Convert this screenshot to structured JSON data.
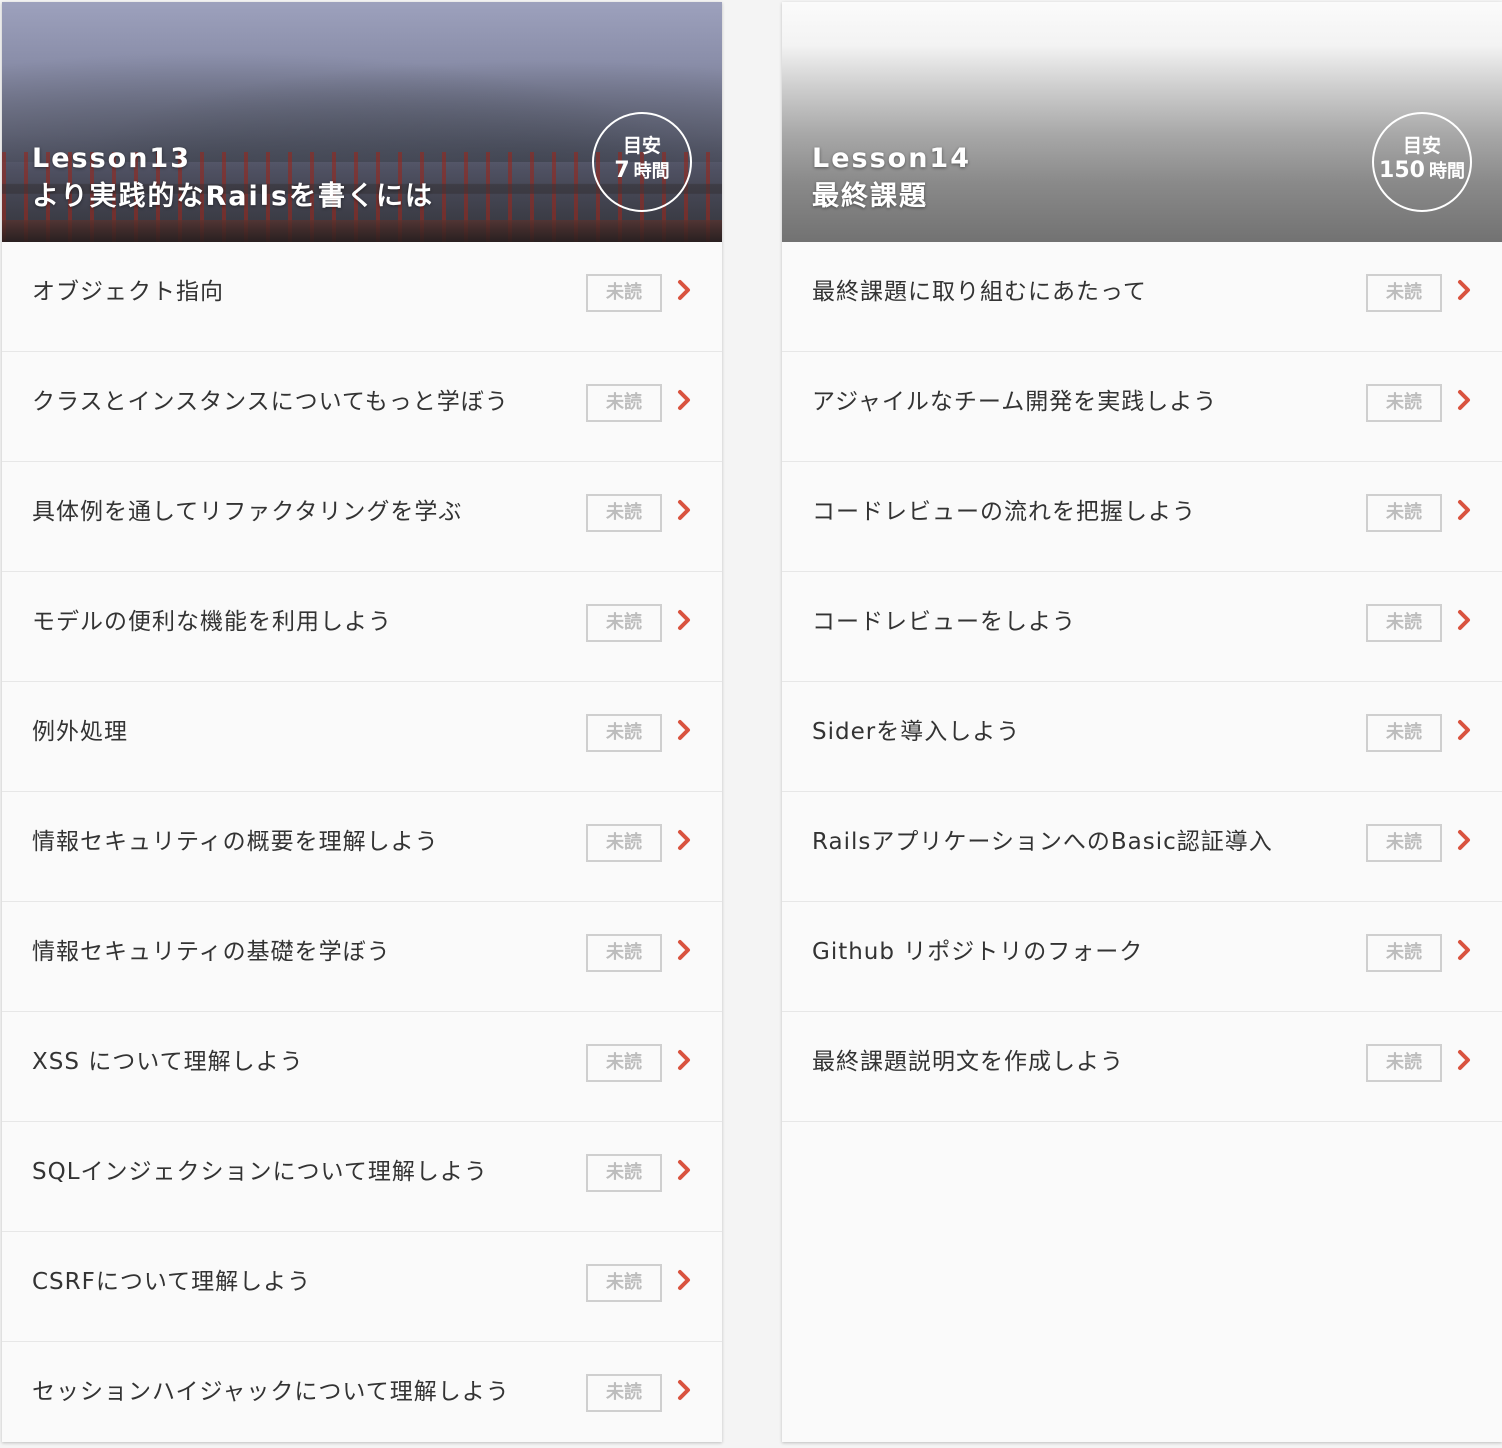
{
  "lessons": [
    {
      "lesson_no": "Lesson13",
      "lesson_name": "より実践的なRailsを書くには",
      "estimate_label": "目安",
      "estimate_value": "7",
      "estimate_unit": "時間",
      "items": [
        {
          "title": "オブジェクト指向",
          "status": "未読"
        },
        {
          "title": "クラスとインスタンスについてもっと学ぼう",
          "status": "未読"
        },
        {
          "title": "具体例を通してリファクタリングを学ぶ",
          "status": "未読"
        },
        {
          "title": "モデルの便利な機能を利用しよう",
          "status": "未読"
        },
        {
          "title": "例外処理",
          "status": "未読"
        },
        {
          "title": "情報セキュリティの概要を理解しよう",
          "status": "未読"
        },
        {
          "title": "情報セキュリティの基礎を学ぼう",
          "status": "未読"
        },
        {
          "title": "XSS について理解しよう",
          "status": "未読"
        },
        {
          "title": "SQLインジェクションについて理解しよう",
          "status": "未読"
        },
        {
          "title": "CSRFについて理解しよう",
          "status": "未読"
        },
        {
          "title": "セッションハイジャックについて理解しよう",
          "status": "未読"
        }
      ]
    },
    {
      "lesson_no": "Lesson14",
      "lesson_name": "最終課題",
      "estimate_label": "目安",
      "estimate_value": "150",
      "estimate_unit": "時間",
      "items": [
        {
          "title": "最終課題に取り組むにあたって",
          "status": "未読"
        },
        {
          "title": "アジャイルなチーム開発を実践しよう",
          "status": "未読"
        },
        {
          "title": "コードレビューの流れを把握しよう",
          "status": "未読"
        },
        {
          "title": "コードレビューをしよう",
          "status": "未読"
        },
        {
          "title": "Siderを導入しよう",
          "status": "未読"
        },
        {
          "title": "RailsアプリケーションへのBasic認証導入",
          "status": "未読"
        },
        {
          "title": "Github リポジトリのフォーク",
          "status": "未読"
        },
        {
          "title": "最終課題説明文を作成しよう",
          "status": "未読"
        }
      ]
    }
  ],
  "colors": {
    "chevron": "#d9533f",
    "badge_border": "#cfcfcf",
    "badge_text": "#bdbdbd",
    "item_text": "#333333",
    "card_bg": "#fafafa"
  },
  "icons": {
    "item_arrow": "chevron-right-icon"
  }
}
